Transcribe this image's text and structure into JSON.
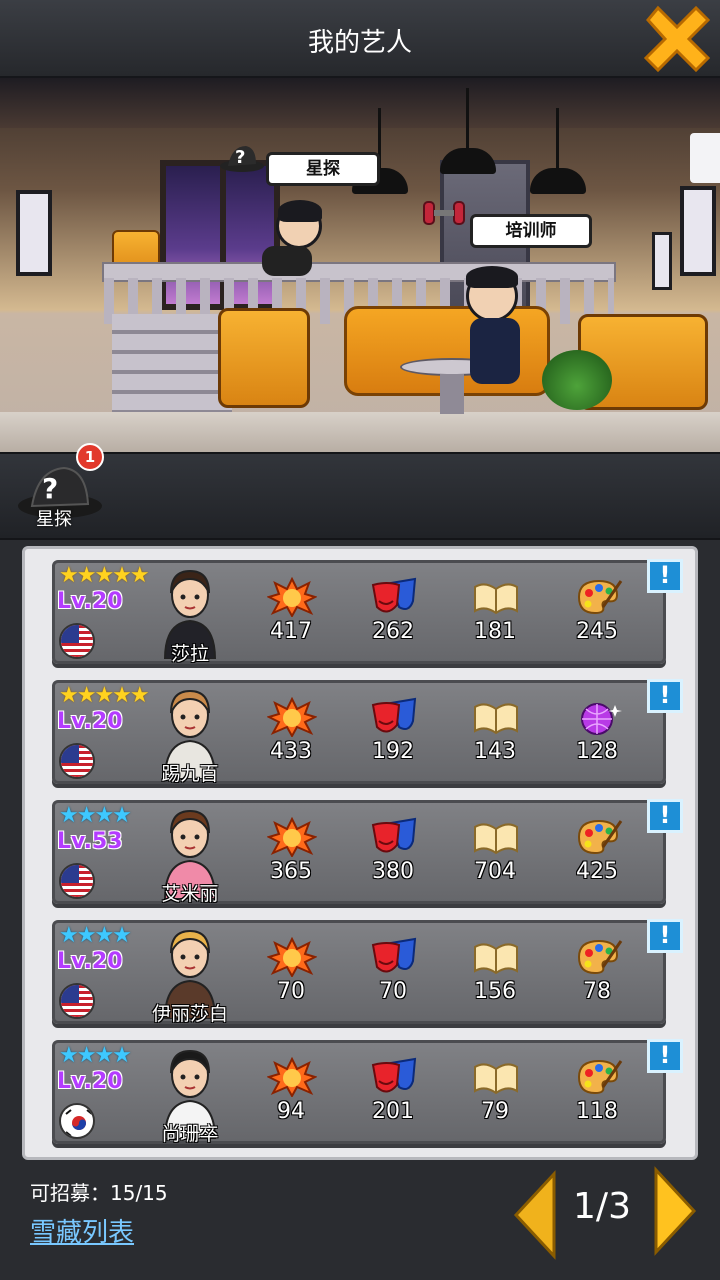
{
  "header": {
    "title": "我的艺人"
  },
  "scene": {
    "scout_tag": "星探",
    "trainer_tag": "培训师"
  },
  "scout": {
    "label": "星探",
    "badge": "1"
  },
  "artists": [
    {
      "name": "莎拉",
      "level": "Lv.20",
      "stars": 5,
      "star_color": "gold",
      "flag": "us",
      "stats": [
        "417",
        "262",
        "181",
        "245"
      ],
      "fourth_icon": "palette-icon"
    },
    {
      "name": "踢九百",
      "level": "Lv.20",
      "stars": 5,
      "star_color": "gold",
      "flag": "us",
      "stats": [
        "433",
        "192",
        "143",
        "128"
      ],
      "fourth_icon": "disco-ball-icon"
    },
    {
      "name": "艾米丽",
      "level": "Lv.53",
      "stars": 4,
      "star_color": "blue",
      "flag": "us",
      "stats": [
        "365",
        "380",
        "704",
        "425"
      ],
      "fourth_icon": "palette-icon"
    },
    {
      "name": "伊丽莎白",
      "level": "Lv.20",
      "stars": 4,
      "star_color": "blue",
      "flag": "us",
      "stats": [
        "70",
        "70",
        "156",
        "78"
      ],
      "fourth_icon": "palette-icon"
    },
    {
      "name": "尚珊卒",
      "level": "Lv.20",
      "stars": 4,
      "star_color": "blue",
      "flag": "kr",
      "stats": [
        "94",
        "201",
        "79",
        "118"
      ],
      "fourth_icon": "palette-icon"
    }
  ],
  "info_label": "!",
  "footer": {
    "recruit_text": "可招募：15/15",
    "vault_link": "雪藏列表",
    "page": "1/3"
  }
}
